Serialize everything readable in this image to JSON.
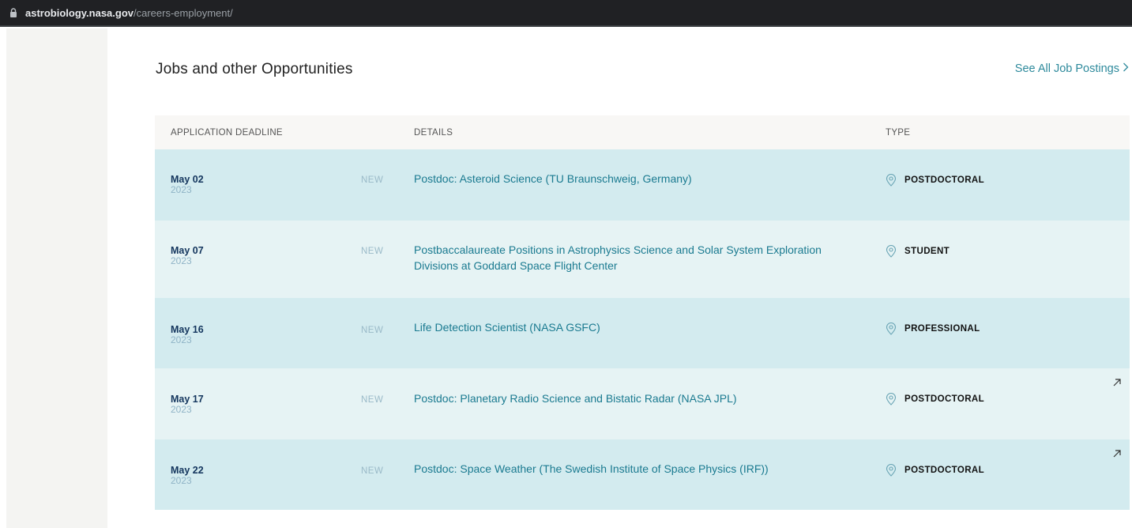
{
  "browser": {
    "url_domain": "astrobiology.nasa.gov",
    "url_path": "/careers-employment/"
  },
  "section": {
    "title": "Jobs and other Opportunities",
    "see_all_label": "See All Job Postings"
  },
  "table": {
    "headers": {
      "deadline": "APPLICATION DEADLINE",
      "details": "DETAILS",
      "type": "TYPE"
    },
    "rows": [
      {
        "date": "May 02",
        "year": "2023",
        "badge": "NEW",
        "title": "Postdoc: Asteroid Science (TU Braunschweig, Germany)",
        "type": "POSTDOCTORAL",
        "external": false
      },
      {
        "date": "May 07",
        "year": "2023",
        "badge": "NEW",
        "title": "Postbaccalaureate Positions in Astrophysics Science and Solar System Exploration Divisions at Goddard Space Flight Center",
        "type": "STUDENT",
        "external": false
      },
      {
        "date": "May 16",
        "year": "2023",
        "badge": "NEW",
        "title": "Life Detection Scientist (NASA GSFC)",
        "type": "PROFESSIONAL",
        "external": false
      },
      {
        "date": "May 17",
        "year": "2023",
        "badge": "NEW",
        "title": "Postdoc: Planetary Radio Science and Bistatic Radar (NASA JPL)",
        "type": "POSTDOCTORAL",
        "external": true
      },
      {
        "date": "May 22",
        "year": "2023",
        "badge": "NEW",
        "title": "Postdoc: Space Weather (The Swedish Institute of Space Physics (IRF))",
        "type": "POSTDOCTORAL",
        "external": true
      }
    ]
  },
  "icons": {
    "lock": "lock-icon",
    "chevron": "chevron-right-icon",
    "pin": "location-pin-icon",
    "external": "external-link-icon"
  },
  "colors": {
    "row_dark": "#d3ebef",
    "row_light": "#e6f3f4",
    "link": "#1a7a90",
    "date": "#13355d"
  }
}
